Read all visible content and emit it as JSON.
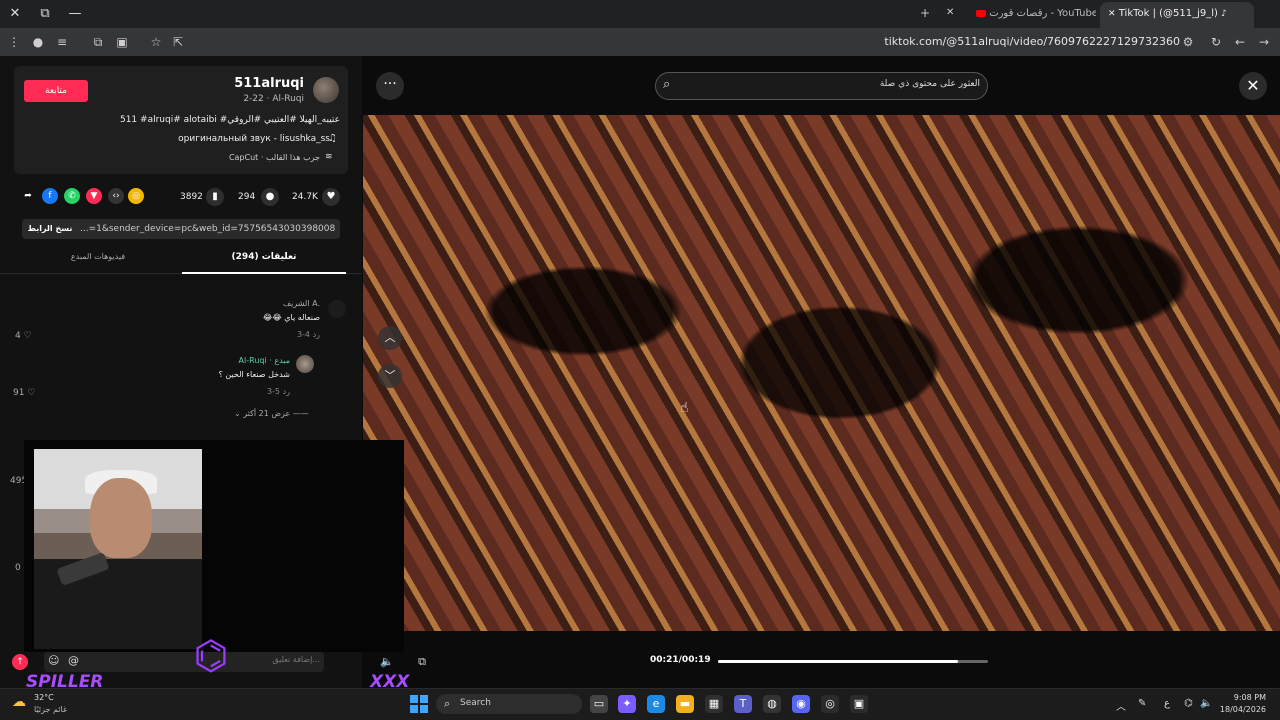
{
  "browser": {
    "tabs": [
      {
        "title": "TikTok | (@511_j9_l)",
        "active": true
      },
      {
        "title": "رقصات قورت - YouTube",
        "active": false
      }
    ],
    "url": "tiktok.com/@511alruqi/video/7609762227129732360",
    "window_buttons": {
      "close": "✕",
      "max": "⧉",
      "min": "—"
    }
  },
  "post": {
    "follow_label": "متابعة",
    "username": "511alruqi",
    "subline": "2-22 · Al-Ruqi",
    "tags": "511 #alruqi# alotaibi #عتيبه_الهيلا #العتيبي #الروقي",
    "sound": "оригинальный звук - lisushka_ss",
    "capcut": "CapCut · جرب هذا القالب",
    "likes": "24.7K",
    "comments": "294",
    "saves": "3892",
    "copy_link_label": "نسخ الرابط",
    "link_text": "...=1&sender_device=pc&web_id=7575654303039800850"
  },
  "tabs": {
    "comments_label": "تعليقات (294)",
    "creator_videos_label": "فيديوهات المبدع"
  },
  "comments": [
    {
      "name": "الشريف A.",
      "text": "😂😂 صنعاله ياي",
      "meta": "3-4   رد",
      "likes": "4"
    },
    {
      "name": "Al-Ruqi · مبدع",
      "text": "شدخل صنعاء الحين ؟",
      "meta": "3-5   رد",
      "likes": "91"
    }
  ],
  "view_more_label": "عرض 21 أكثر",
  "side_counts": [
    "495",
    "0"
  ],
  "comment_placeholder": "إضافة تعليق...",
  "search": {
    "placeholder": "العثور على محتوى ذي صلة"
  },
  "player": {
    "timecode": "00:21/00:19",
    "progress": 0.89
  },
  "overlay": {
    "brand_left": "SPILLER",
    "brand_right": "XXX"
  },
  "taskbar": {
    "weather_temp": "32°C",
    "weather_desc": "غائم جزئيًا",
    "search_label": "Search",
    "time": "9:08 PM",
    "date": "18/04/2026",
    "lang": "ع"
  },
  "colors": {
    "accent": "#fe2c55",
    "brand": "#a84cff"
  }
}
